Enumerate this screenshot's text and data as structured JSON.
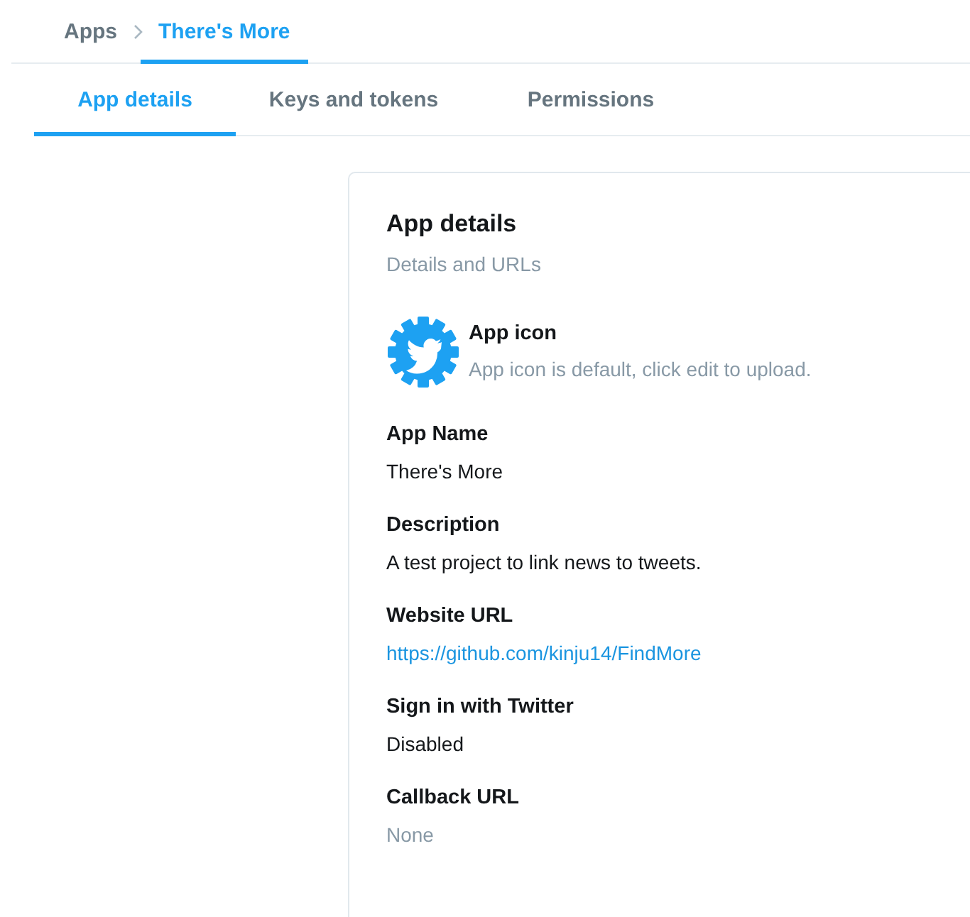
{
  "breadcrumbs": [
    {
      "label": "Apps",
      "selected": false
    },
    {
      "label": "There's More",
      "selected": true
    }
  ],
  "tabs": [
    {
      "label": "App details",
      "selected": true
    },
    {
      "label": "Keys and tokens",
      "selected": false
    },
    {
      "label": "Permissions",
      "selected": false
    }
  ],
  "card": {
    "title": "App details",
    "subtitle": "Details and URLs",
    "app_icon": {
      "label": "App icon",
      "hint": "App icon is default, click edit to upload."
    },
    "fields": [
      {
        "label": "App Name",
        "value": "There's More",
        "kind": "text"
      },
      {
        "label": "Description",
        "value": "A test project to link news to tweets.",
        "kind": "text"
      },
      {
        "label": "Website URL",
        "value": "https://github.com/kinju14/FindMore",
        "kind": "link"
      },
      {
        "label": "Sign in with Twitter",
        "value": "Disabled",
        "kind": "text"
      },
      {
        "label": "Callback URL",
        "value": "None",
        "kind": "empty"
      }
    ]
  }
}
